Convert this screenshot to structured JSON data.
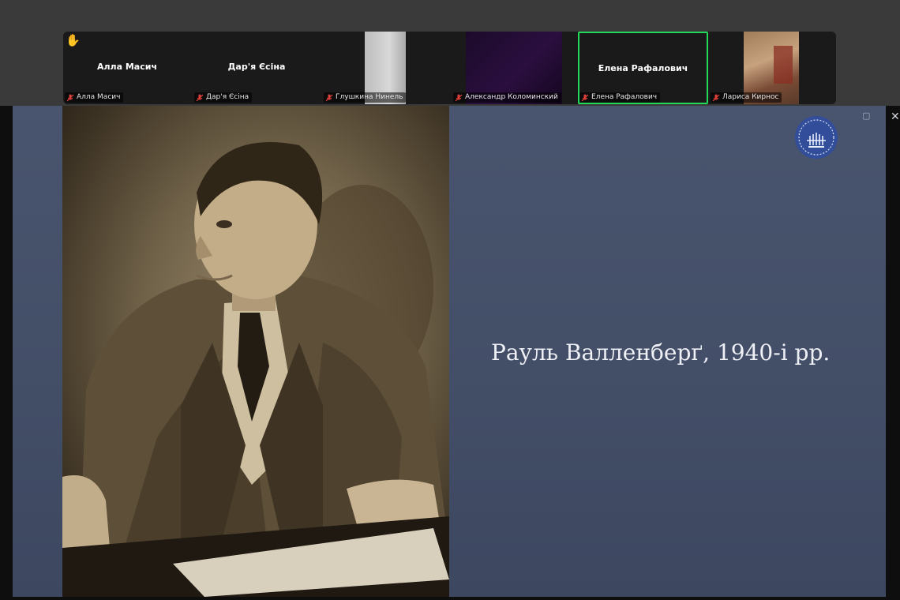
{
  "participants": [
    {
      "name": "Алла Масич",
      "title": "Алла Масич",
      "muted": true,
      "raised_hand": true
    },
    {
      "name": "Дар'я Єсіна",
      "title": "Дар'я Єсіна",
      "muted": true
    },
    {
      "name": "Глушкина Нинель",
      "muted": true,
      "video": true
    },
    {
      "name": "Александр Коломинский",
      "muted": true,
      "video": true
    },
    {
      "name": "Елена Рафалович",
      "title": "Елена Рафалович",
      "muted": true,
      "active_speaker": true
    },
    {
      "name": "Лариса Кирнос",
      "muted": true,
      "video": true
    }
  ],
  "slide": {
    "caption": "Рауль Валленберґ, 1940-і рр."
  },
  "colors": {
    "active_speaker_border": "#23d959",
    "muted_icon": "#e0403a",
    "slide_background": "#47526b"
  }
}
